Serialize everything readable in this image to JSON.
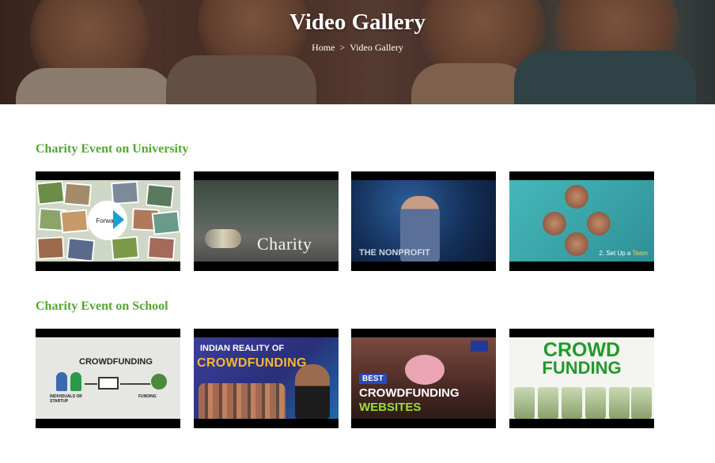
{
  "hero": {
    "title": "Video Gallery",
    "breadcrumb": {
      "home": "Home",
      "separator": ">",
      "current": "Video Gallery"
    }
  },
  "sections": [
    {
      "title": "Charity Event on University",
      "videos": [
        {
          "logo_text": "Forward"
        },
        {
          "overlay_text": "Charity"
        },
        {
          "overlay_text": "THE NONPROFIT"
        },
        {
          "caption_prefix": "2. Set Up a ",
          "caption_highlight": "Team"
        }
      ]
    },
    {
      "title": "Charity Event on School",
      "videos": [
        {
          "title": "CROWDFUNDING",
          "left_label": "INDIVIDUALS OR STARTUP",
          "right_label": "FUNDING"
        },
        {
          "line1": "INDIAN REALITY OF",
          "line2": "CROWDFUNDING"
        },
        {
          "badge": "BEST",
          "line1": "CROWDFUNDING",
          "line2": "WEBSITES"
        },
        {
          "line1": "CROWD",
          "line2": "FUNDING"
        }
      ]
    }
  ],
  "colors": {
    "accent_green": "#55a632",
    "thumb_border": "#000000"
  }
}
